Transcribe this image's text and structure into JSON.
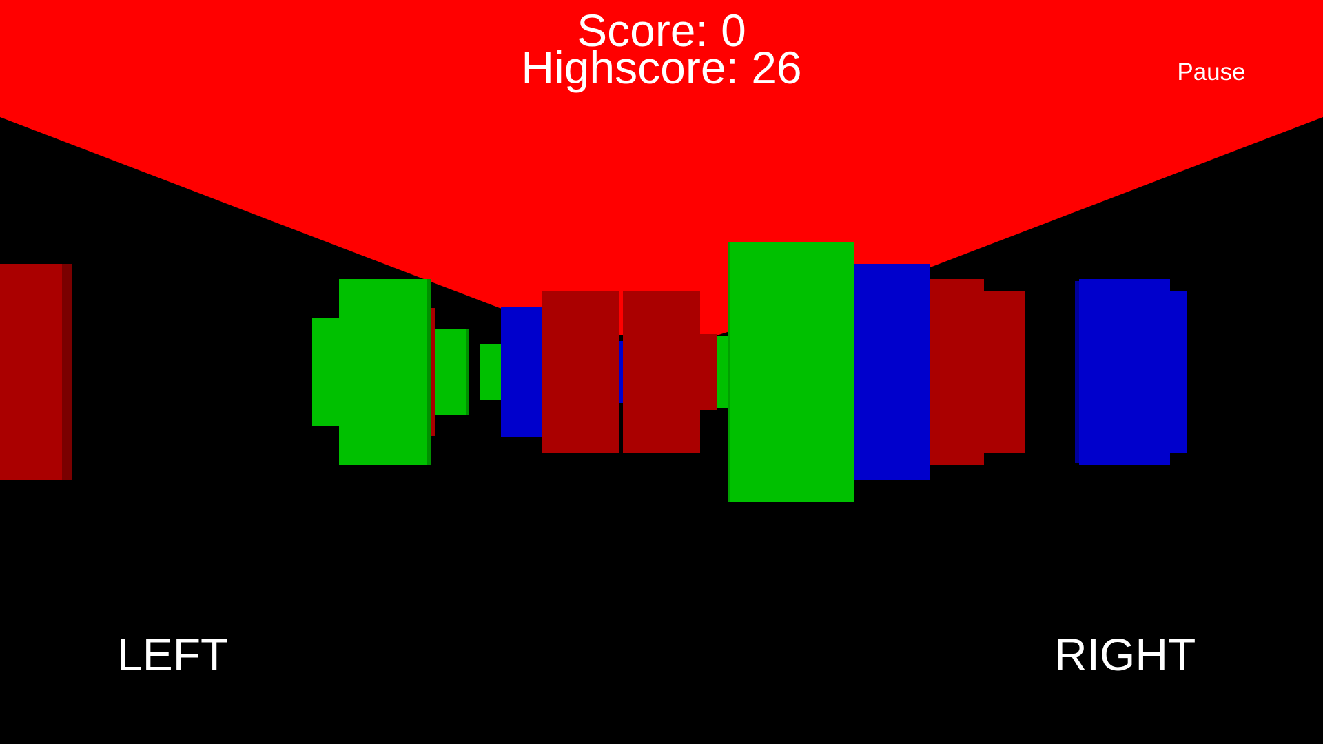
{
  "hud": {
    "score_text": "Score: 0",
    "highscore_text": "Highscore: 26",
    "pause_label": "Pause"
  },
  "controls": {
    "left_label": "LEFT",
    "right_label": "RIGHT"
  },
  "colors": {
    "background": "#000000",
    "ceiling": "#ff0000",
    "block_red": "#aa0000",
    "block_red_side": "#7a0000",
    "block_green": "#00c000",
    "block_green_side": "#009000",
    "block_blue": "#0000cc",
    "block_blue_side": "#00009a",
    "hud_text": "#ffffff"
  }
}
